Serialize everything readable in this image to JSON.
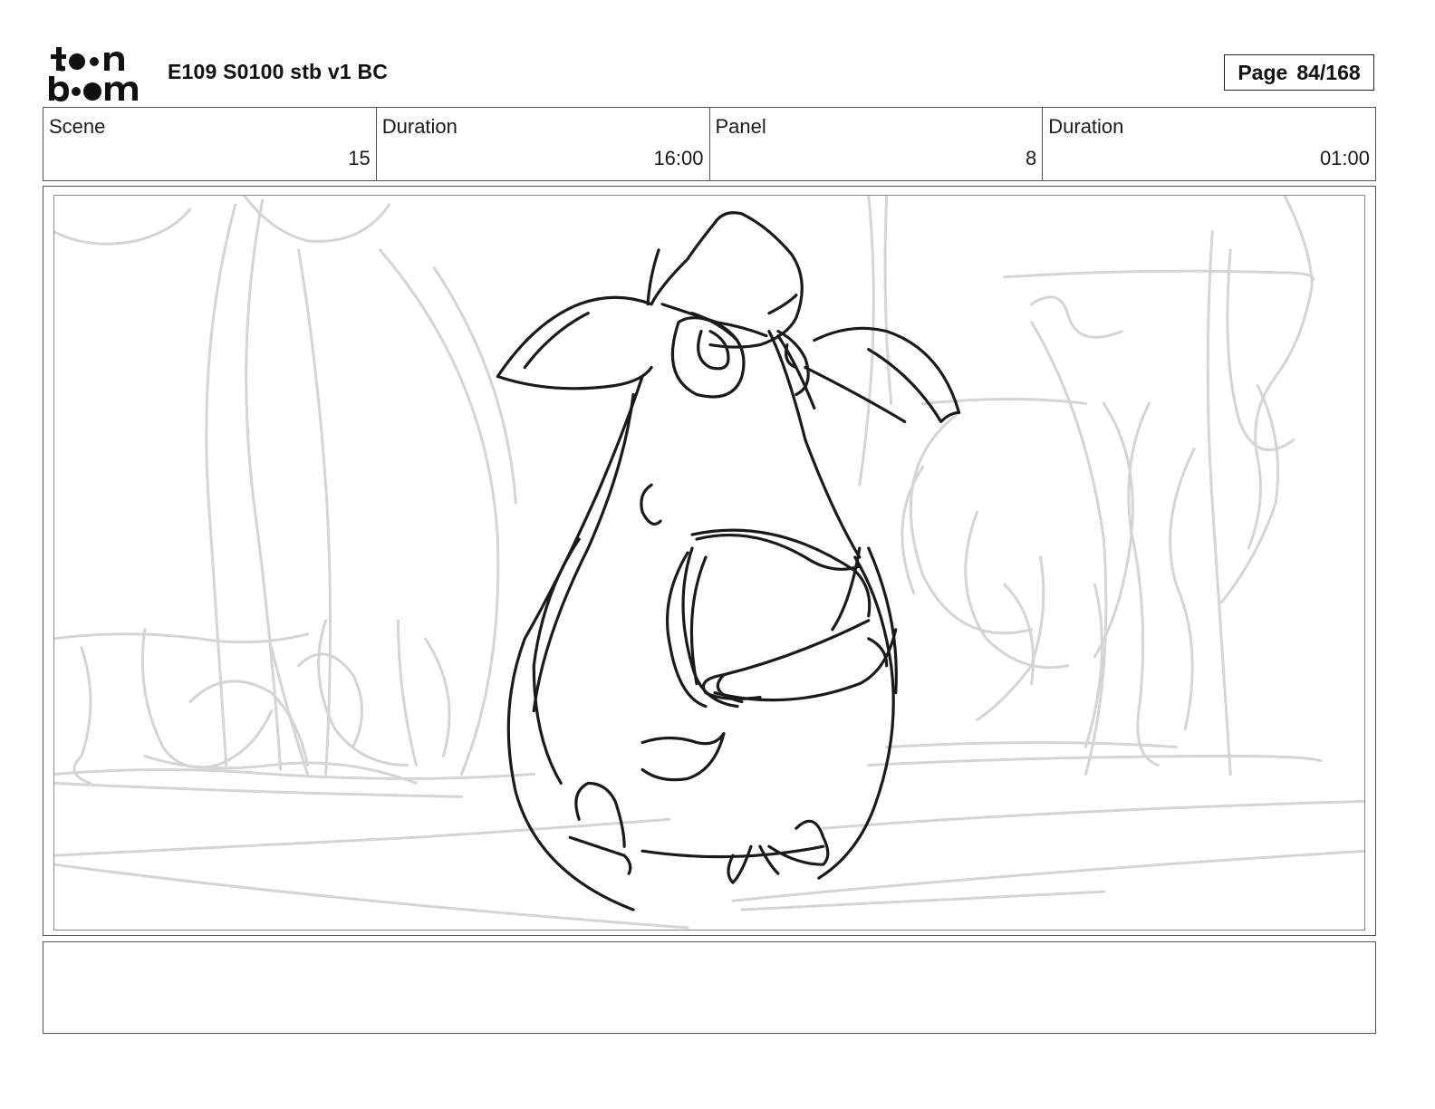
{
  "header": {
    "logo_text": "toon boom",
    "title": "E109 S0100 stb v1 BC",
    "page_label": "Page",
    "page_number": "84/168"
  },
  "info": {
    "scene_label": "Scene",
    "scene_value": "15",
    "scene_duration_label": "Duration",
    "scene_duration_value": "16:00",
    "panel_label": "Panel",
    "panel_value": "8",
    "panel_duration_label": "Duration",
    "panel_duration_value": "01:00"
  },
  "panel": {
    "image_subject": "rough sketch of a pear-shaped cow-like character with a hat, arms crossed, trees sketched in the background"
  },
  "notes": {
    "text": ""
  }
}
